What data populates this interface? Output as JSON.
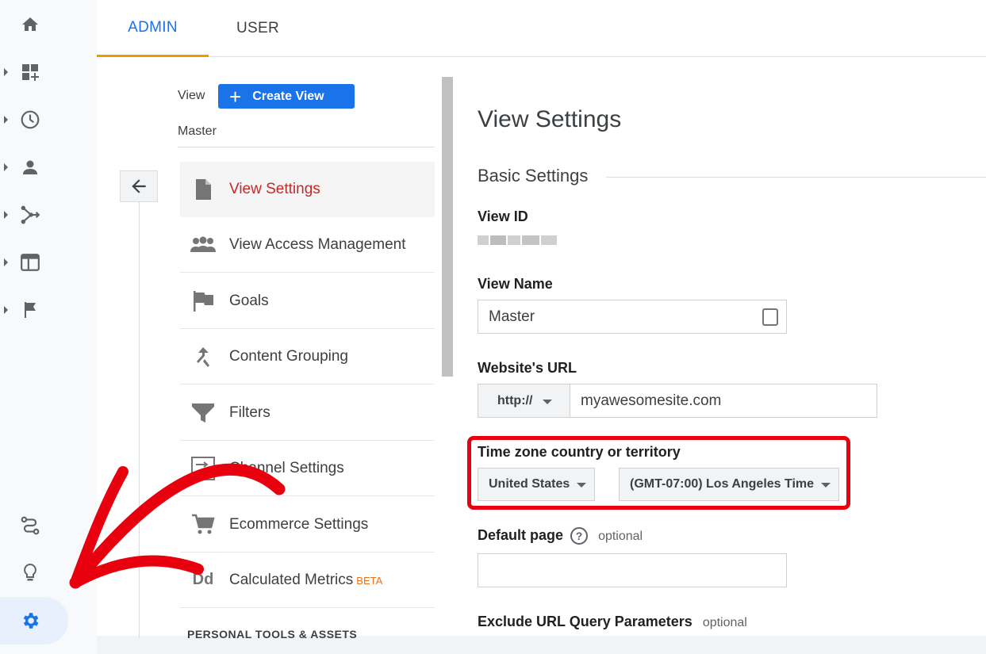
{
  "tabs": {
    "admin": "ADMIN",
    "user": "USER"
  },
  "left_rail": {
    "items": [
      {
        "icon": "home-icon"
      },
      {
        "icon": "customization-icon"
      },
      {
        "icon": "realtime-icon"
      },
      {
        "icon": "audience-icon"
      },
      {
        "icon": "acquisition-icon"
      },
      {
        "icon": "behavior-icon"
      },
      {
        "icon": "conversions-icon"
      }
    ],
    "bottom": [
      {
        "icon": "attribution-icon"
      },
      {
        "icon": "discover-icon"
      },
      {
        "icon": "admin-gear-icon"
      }
    ]
  },
  "view_column": {
    "view_label": "View",
    "create_button": "Create View",
    "view_name": "Master",
    "items": [
      {
        "label": "View Settings",
        "icon": "document-icon",
        "selected": true
      },
      {
        "label": "View Access Management",
        "icon": "people-icon"
      },
      {
        "label": "Goals",
        "icon": "flag-icon"
      },
      {
        "label": "Content Grouping",
        "icon": "merge-icon"
      },
      {
        "label": "Filters",
        "icon": "filter-icon"
      },
      {
        "label": "Channel Settings",
        "icon": "channel-icon"
      },
      {
        "label": "Ecommerce Settings",
        "icon": "cart-icon"
      },
      {
        "label": "Calculated Metrics",
        "badge": "BETA",
        "icon": "calculated-icon",
        "icon_text": "Dd"
      }
    ],
    "section_personal": "PERSONAL TOOLS & ASSETS"
  },
  "settings": {
    "title": "View Settings",
    "section": "Basic Settings",
    "view_id_label": "View ID",
    "view_name_label": "View Name",
    "view_name_value": "Master",
    "website_url_label": "Website's URL",
    "protocol": "http://",
    "website_url_value": "myawesomesite.com",
    "timezone_label": "Time zone country or territory",
    "country": "United States",
    "timezone": "(GMT-07:00) Los Angeles Time",
    "default_page_label": "Default page",
    "help_glyph": "?",
    "default_page_optional": "optional",
    "exclude_label": "Exclude URL Query Parameters",
    "exclude_optional": "optional"
  },
  "colors": {
    "accent": "#1a73e8",
    "tab_underline": "#f29900",
    "selected_text": "#c62828",
    "annotation_red": "#e8000f"
  }
}
